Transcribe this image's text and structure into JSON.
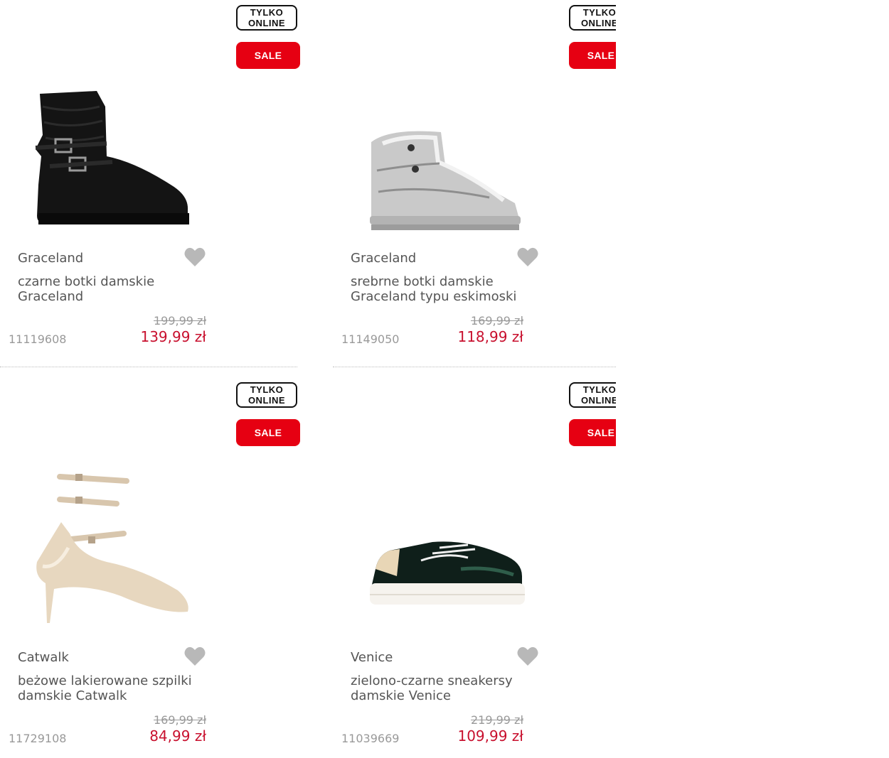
{
  "products": [
    {
      "badge_online_line1": "TYLKO",
      "badge_online_line2": "ONLINE",
      "badge_sale": "SALE",
      "brand": "Graceland",
      "title": "czarne botki damskie Graceland",
      "old_price": "199,99 zł",
      "new_price": "139,99 zł",
      "sku": "11119608",
      "image": "black-boot-icon"
    },
    {
      "badge_online_line1": "TYLKO",
      "badge_online_line2": "ONLINE",
      "badge_sale": "SALE",
      "brand": "Graceland",
      "title": "srebrne botki damskie Graceland typu eskimoski",
      "old_price": "169,99 zł",
      "new_price": "118,99 zł",
      "sku": "11149050",
      "image": "silver-snow-boot-icon"
    },
    {
      "badge_online_line1": "TYLKO",
      "badge_online_line2": "ONLINE",
      "badge_sale": "SALE",
      "brand": "Catwalk",
      "title": "beżowe lakierowane szpilki damskie Catwalk",
      "old_price": "169,99 zł",
      "new_price": "84,99 zł",
      "sku": "11729108",
      "image": "beige-pump-icon"
    },
    {
      "badge_online_line1": "TYLKO",
      "badge_online_line2": "ONLINE",
      "badge_sale": "SALE",
      "brand": "Venice",
      "title": "zielono-czarne sneakersy damskie Venice",
      "old_price": "219,99 zł",
      "new_price": "109,99 zł",
      "sku": "11039669",
      "image": "green-black-sneaker-icon"
    }
  ],
  "colors": {
    "sale_red": "#e60012",
    "price_red": "#c8102e",
    "heart_grey": "#b8b8b8"
  }
}
